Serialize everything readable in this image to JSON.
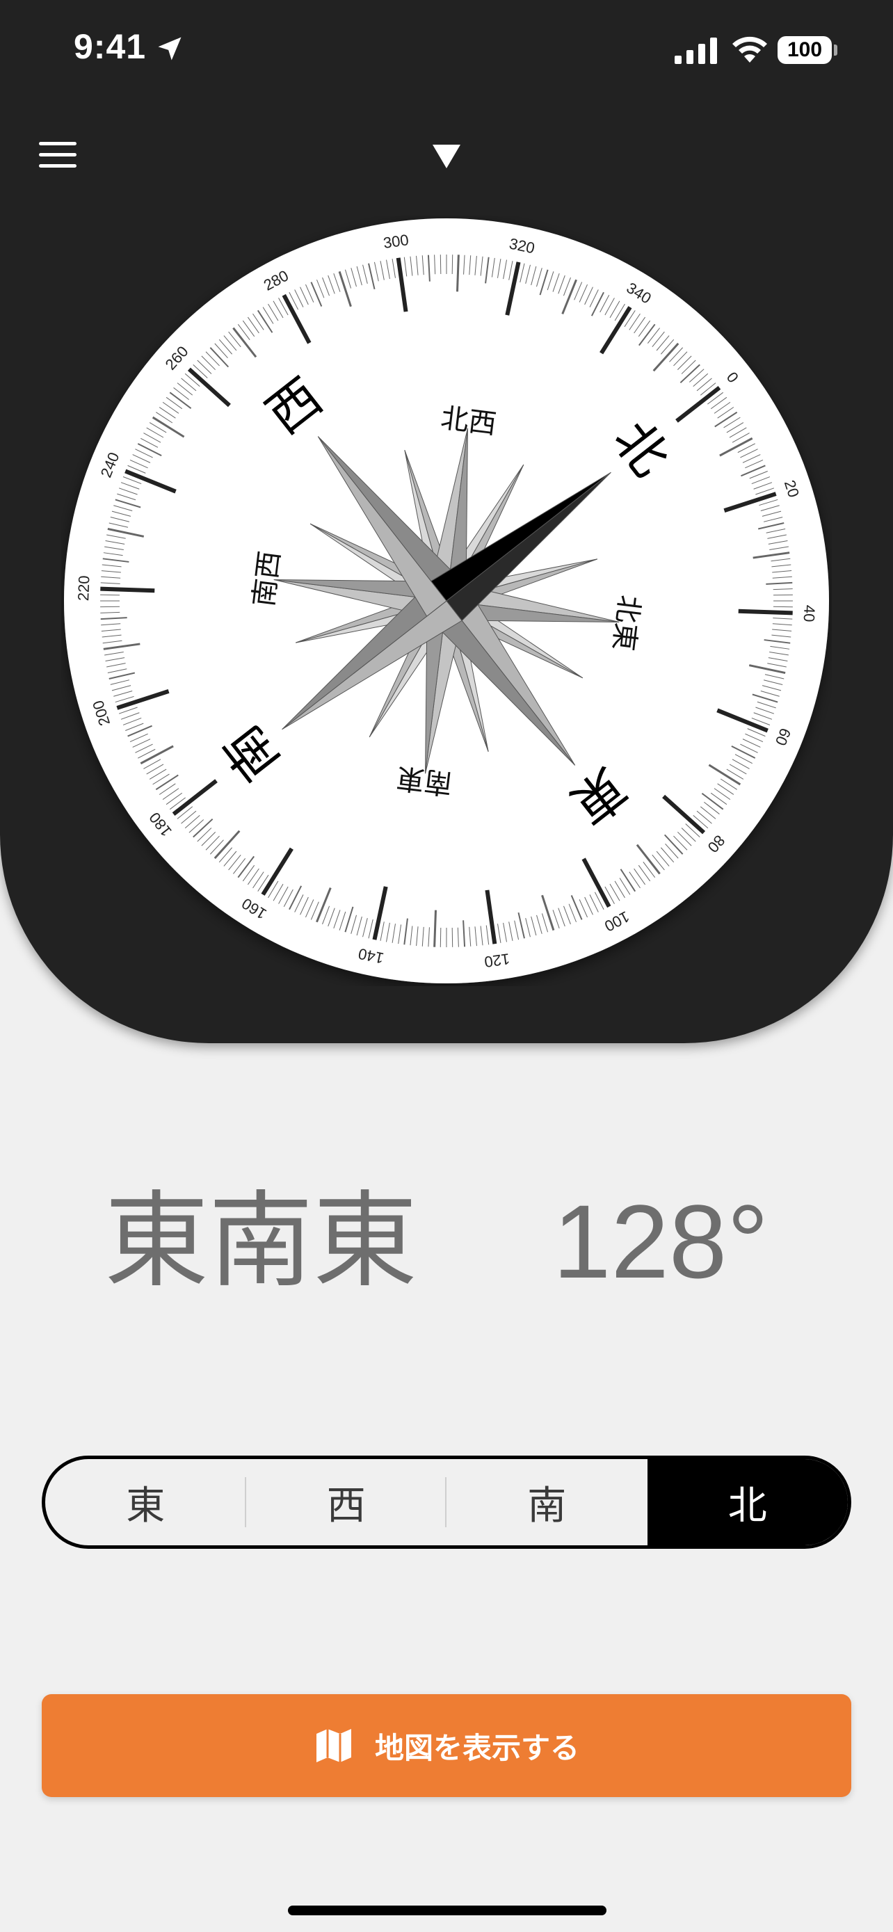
{
  "status_bar": {
    "time": "9:41",
    "battery": "100"
  },
  "compass": {
    "heading_deg": 128,
    "cardinals": [
      "北",
      "東",
      "南",
      "西"
    ],
    "intercardinals": [
      "北東",
      "南東",
      "南西",
      "北西"
    ],
    "scale_labels": [
      "0",
      "20",
      "40",
      "60",
      "80",
      "100",
      "120",
      "140",
      "160",
      "180",
      "200",
      "220",
      "240",
      "260",
      "280",
      "300",
      "320",
      "340"
    ]
  },
  "readout": {
    "direction": "東南東",
    "degrees": "128°"
  },
  "segmented_control": {
    "options": [
      "東",
      "西",
      "南",
      "北"
    ],
    "selected": "北"
  },
  "map_button": {
    "label": "地図を表示する"
  },
  "colors": {
    "header_bg": "#222222",
    "page_bg": "#f0f0f0",
    "accent_orange": "#ee7d33",
    "text_gray": "#6e6e6e"
  }
}
